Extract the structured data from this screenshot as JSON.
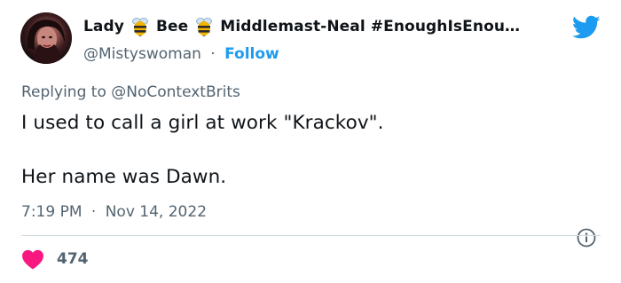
{
  "tweet": {
    "author": {
      "name_part1": "Lady",
      "name_part2": "Bee",
      "name_part3": "Middlemast-Neal #EnoughIsEnou…",
      "emoji_icon": "bee-icon",
      "handle": "@Mistyswoman",
      "separator": "·",
      "follow_label": "Follow"
    },
    "logo_icon": "twitter-bird-icon",
    "reply_prefix": "Replying to",
    "reply_mention": "@NoContextBrits",
    "text_line1": "I used to call a girl at work \"Krackov\".",
    "text_line2": "Her name was Dawn.",
    "time": "7:19 PM",
    "meta_separator": "·",
    "date": "Nov 14, 2022",
    "info_icon": "info-icon",
    "like_icon": "heart-icon",
    "like_count": "474",
    "colors": {
      "accent": "#1d9bf0",
      "heart": "#f91880",
      "muted": "#536471",
      "text": "#0f1419",
      "divider": "#cfd9de"
    }
  }
}
